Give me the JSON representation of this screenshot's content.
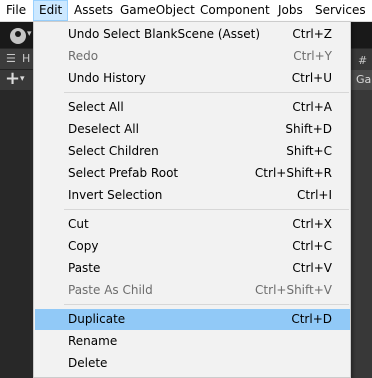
{
  "menubar": {
    "items": [
      {
        "label": "File"
      },
      {
        "label": "Edit"
      },
      {
        "label": "Assets"
      },
      {
        "label": "GameObject"
      },
      {
        "label": "Component"
      },
      {
        "label": "Jobs"
      },
      {
        "label": "Services"
      }
    ]
  },
  "background": {
    "hierarchy_tab_label": "H",
    "right_tab_symbol": "#",
    "right_tab_label": "Ga"
  },
  "edit_menu": {
    "items": [
      {
        "label": "Undo Select BlankScene (Asset)",
        "shortcut": "Ctrl+Z",
        "enabled": true
      },
      {
        "label": "Redo",
        "shortcut": "Ctrl+Y",
        "enabled": false
      },
      {
        "label": "Undo History",
        "shortcut": "Ctrl+U",
        "enabled": true
      },
      {
        "label": "Select All",
        "shortcut": "Ctrl+A",
        "enabled": true
      },
      {
        "label": "Deselect All",
        "shortcut": "Shift+D",
        "enabled": true
      },
      {
        "label": "Select Children",
        "shortcut": "Shift+C",
        "enabled": true
      },
      {
        "label": "Select Prefab Root",
        "shortcut": "Ctrl+Shift+R",
        "enabled": true
      },
      {
        "label": "Invert Selection",
        "shortcut": "Ctrl+I",
        "enabled": true
      },
      {
        "label": "Cut",
        "shortcut": "Ctrl+X",
        "enabled": true
      },
      {
        "label": "Copy",
        "shortcut": "Ctrl+C",
        "enabled": true
      },
      {
        "label": "Paste",
        "shortcut": "Ctrl+V",
        "enabled": true
      },
      {
        "label": "Paste As Child",
        "shortcut": "Ctrl+Shift+V",
        "enabled": false
      },
      {
        "label": "Duplicate",
        "shortcut": "Ctrl+D",
        "enabled": true,
        "highlighted": true
      },
      {
        "label": "Rename",
        "shortcut": "",
        "enabled": true
      },
      {
        "label": "Delete",
        "shortcut": "",
        "enabled": true
      }
    ]
  },
  "colors": {
    "highlight": "#91c9f7",
    "menu_bg": "#f2f2f2",
    "disabled_text": "#6d6d6d",
    "active_menubar_bg": "#cce8ff"
  }
}
